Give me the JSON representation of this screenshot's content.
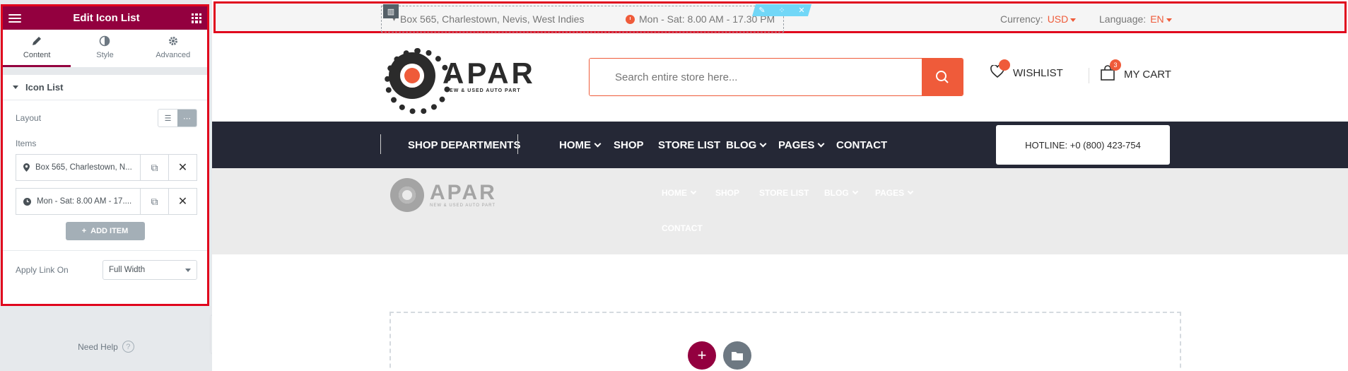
{
  "panel": {
    "title": "Edit Icon List",
    "tabs": [
      {
        "label": "Content",
        "icon": "pencil-icon"
      },
      {
        "label": "Style",
        "icon": "contrast-icon"
      },
      {
        "label": "Advanced",
        "icon": "gear-icon"
      }
    ],
    "section_title": "Icon List",
    "layout_label": "Layout",
    "items_label": "Items",
    "items": [
      {
        "text": "Box 565, Charlestown, N...",
        "icon": "map-pin-icon"
      },
      {
        "text": "Mon - Sat: 8.00 AM - 17....",
        "icon": "clock-icon"
      }
    ],
    "add_item_label": "ADD ITEM",
    "apply_link_label": "Apply Link On",
    "apply_link_value": "Full Width",
    "need_help": "Need Help",
    "accent_color": "#93003f"
  },
  "topbar": {
    "address": "Box 565, Charlestown, Nevis, West Indies",
    "hours": "Mon - Sat: 8.00 AM - 17.30 PM",
    "currency_label": "Currency:",
    "currency_value": "USD",
    "language_label": "Language:",
    "language_value": "EN"
  },
  "header": {
    "logo_text": "APAR",
    "logo_tagline": "NEW & USED AUTO PART",
    "search_placeholder": "Search entire store here...",
    "wishlist_label": "WISHLIST",
    "cart_label": "MY CART",
    "cart_count": "3",
    "accent_color": "#ef5b3a"
  },
  "nav": {
    "departments": "SHOP DEPARTMENTS",
    "items": [
      "HOME",
      "SHOP",
      "STORE LIST",
      "BLOG",
      "PAGES",
      "CONTACT"
    ],
    "hotline": "HOTLINE: +0 (800) 423-754",
    "background": "#252836"
  },
  "sticky": {
    "logo_text": "APAR",
    "logo_tagline": "NEW & USED AUTO PART",
    "items": [
      "HOME",
      "SHOP",
      "STORE LIST",
      "BLOG",
      "PAGES",
      "CONTACT"
    ]
  }
}
